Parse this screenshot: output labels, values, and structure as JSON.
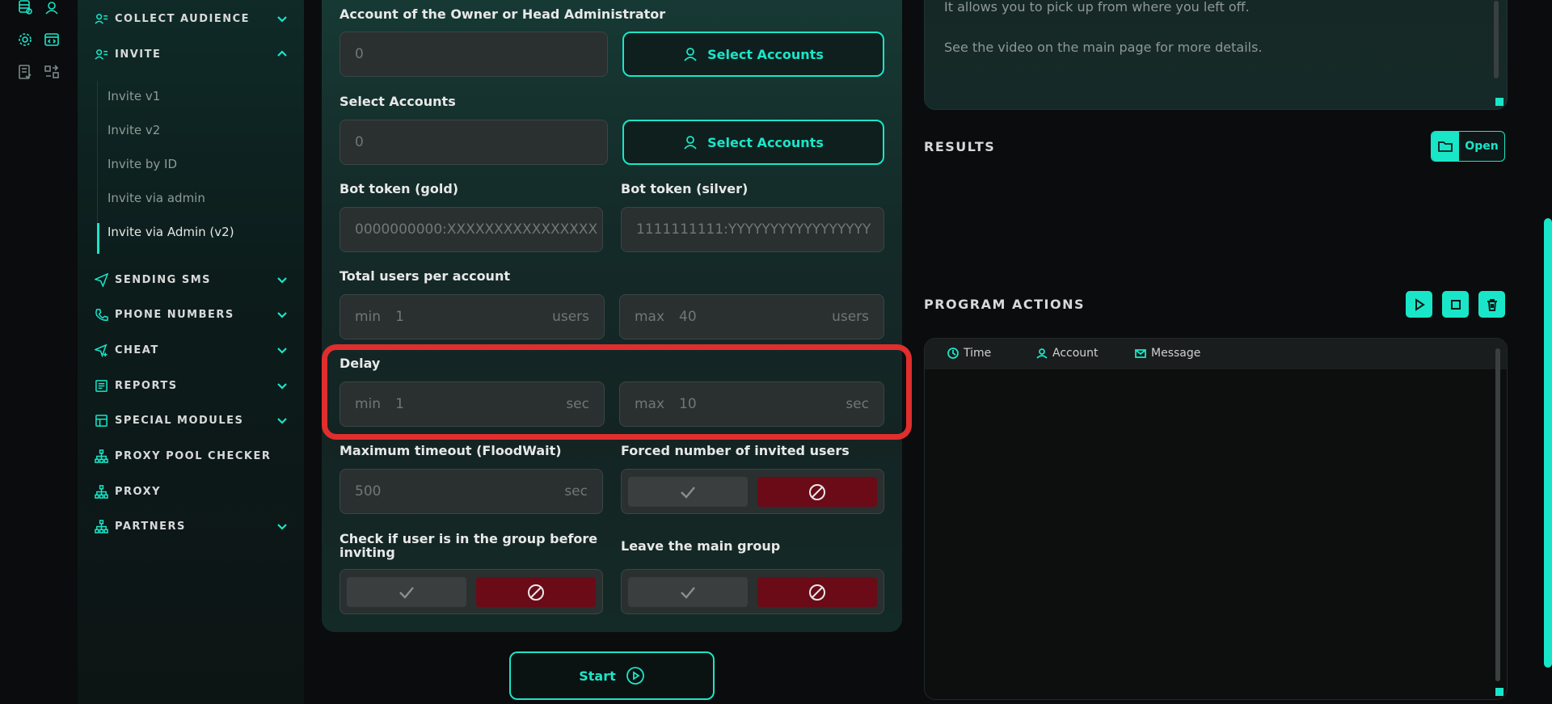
{
  "colors": {
    "accent": "#19e6c8",
    "danger": "#6b0b18",
    "highlight": "#e02e2e"
  },
  "rail": {
    "icons": [
      "database-icon",
      "user-circle-icon",
      "gear-icon",
      "code-window-icon",
      "checklist-icon",
      "swap-icon"
    ]
  },
  "sidebar": {
    "items": [
      {
        "label": "COLLECT AUDIENCE",
        "icon": "users-list-icon",
        "expanded": false
      },
      {
        "label": "INVITE",
        "icon": "users-list-icon",
        "expanded": true
      },
      {
        "label": "SENDING SMS",
        "icon": "send-icon",
        "expanded": false
      },
      {
        "label": "PHONE NUMBERS",
        "icon": "phone-icon",
        "expanded": false
      },
      {
        "label": "CHEAT",
        "icon": "send-plus-icon",
        "expanded": false
      },
      {
        "label": "REPORTS",
        "icon": "report-icon",
        "expanded": false
      },
      {
        "label": "SPECIAL MODULES",
        "icon": "modules-icon",
        "expanded": false
      },
      {
        "label": "PROXY POOL CHECKER",
        "icon": "network-icon"
      },
      {
        "label": "PROXY",
        "icon": "network-icon"
      },
      {
        "label": "PARTNERS",
        "icon": "network-icon",
        "expanded": false
      }
    ],
    "invite_sub": [
      "Invite v1",
      "Invite v2",
      "Invite by ID",
      "Invite via admin",
      "Invite via Admin (v2)"
    ]
  },
  "form": {
    "owner_label": "Account of the Owner or Head Administrator",
    "owner_value": "0",
    "select_btn": "Select Accounts",
    "select_label": "Select Accounts",
    "select_value": "0",
    "bot_gold_label": "Bot token (gold)",
    "bot_gold_placeholder": "0000000000:XXXXXXXXXXXXXXXX",
    "bot_silver_label": "Bot token (silver)",
    "bot_silver_placeholder": "1111111111:YYYYYYYYYYYYYYYYY",
    "total_label": "Total users per account",
    "min": "min",
    "max": "max",
    "total_min": "1",
    "total_max": "40",
    "users_unit": "users",
    "delay_label": "Delay",
    "delay_min": "1",
    "delay_max": "10",
    "sec_unit": "sec",
    "timeout_label": "Maximum timeout (FloodWait)",
    "timeout_value": "500",
    "forced_label": "Forced number of invited users",
    "check_label_1": "Check if user is in the group before",
    "check_label_2": "inviting",
    "leave_label": "Leave the main group",
    "start": "Start"
  },
  "notes": {
    "line1": "It allows you to pick up from where you left off.",
    "line2": "See the video on the main page for more details."
  },
  "results": {
    "title": "RESULTS",
    "open": "Open"
  },
  "actions": {
    "title": "PROGRAM ACTIONS",
    "cols": [
      "Time",
      "Account",
      "Message"
    ]
  }
}
